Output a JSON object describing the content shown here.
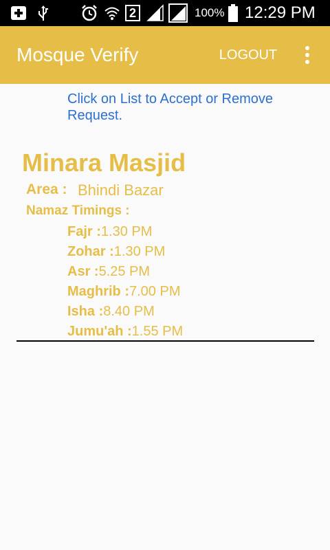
{
  "status_bar": {
    "battery_percent": "100%",
    "time": "12:29 PM",
    "sim_number": "2",
    "icons": [
      "add-notification-icon",
      "usb-icon",
      "alarm-icon",
      "wifi-icon",
      "sim-2-icon",
      "signal-icon",
      "signal-icon",
      "battery-icon"
    ]
  },
  "app_bar": {
    "title": "Mosque Verify",
    "logout_label": "LOGOUT",
    "overflow_icon": "more-vert-icon"
  },
  "instruction": "Click on List to Accept or Remove Request.",
  "colors": {
    "accent": "#e6be47",
    "link": "#2a6fd1"
  },
  "request": {
    "name": "Minara Masjid",
    "area_label": "Area :",
    "area_value": "Bhindi Bazar",
    "timings_label": "Namaz Timings :",
    "timings": [
      {
        "name": "Fajr :",
        "time": "1.30 PM"
      },
      {
        "name": "Zohar :",
        "time": "1.30 PM"
      },
      {
        "name": "Asr :",
        "time": "5.25 PM"
      },
      {
        "name": "Maghrib :",
        "time": "7.00 PM"
      },
      {
        "name": "Isha :",
        "time": "8.40 PM"
      },
      {
        "name": "Jumu'ah :",
        "time": "1.55 PM"
      }
    ]
  }
}
